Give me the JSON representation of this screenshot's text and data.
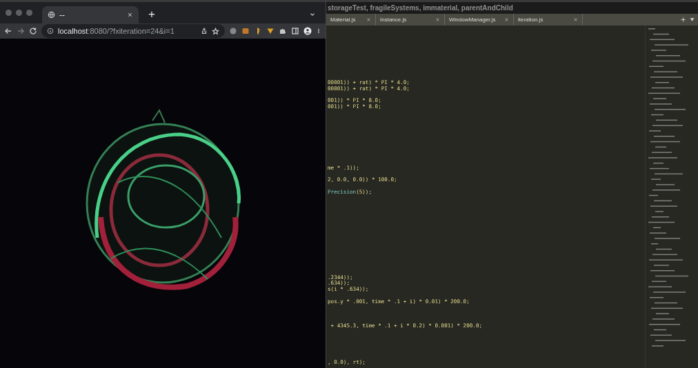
{
  "browser": {
    "tab": {
      "title": "--",
      "selected": true
    },
    "new_tab": "+",
    "url_host": "localhost",
    "url_rest": ":8080/?fxiteration=24&i=1"
  },
  "editor": {
    "title": "storageTest, fragileSystems, immaterial, parentAndChild",
    "tabs": [
      {
        "label": "Material.js",
        "selected": false
      },
      {
        "label": "Instance.js",
        "selected": false
      },
      {
        "label": "WindowManager.js",
        "selected": false
      },
      {
        "label": "iteration.js",
        "selected": false
      }
    ],
    "code": [
      {
        "text": "00001)) + rat) * PI * 4.0;"
      },
      {
        "text": "00001)) + rat) * PI * 4.0;"
      },
      {
        "text": "001)) * PI * 8.0;"
      },
      {
        "text": "001)) * PI * 8.0;"
      },
      {
        "text": "me * .1));"
      },
      {
        "text": "2, 0.0, 0.0)) * 100.0;"
      },
      {
        "segments": [
          {
            "text": "Precision",
            "kind": "method"
          },
          {
            "text": "(5));",
            "kind": "plain"
          }
        ]
      },
      {
        "text": ".2344));"
      },
      {
        "text": ".634));"
      },
      {
        "text": "s(i * .634));"
      },
      {
        "text": "pos.y * .001, time * .1 + i) * 0.01) * 200.0;"
      },
      {
        "text": " + 4345.3, time * .1 + i * 0.2) * 0.001) * 200.0;"
      },
      {
        "text": ", 0.0), rt);"
      }
    ]
  }
}
